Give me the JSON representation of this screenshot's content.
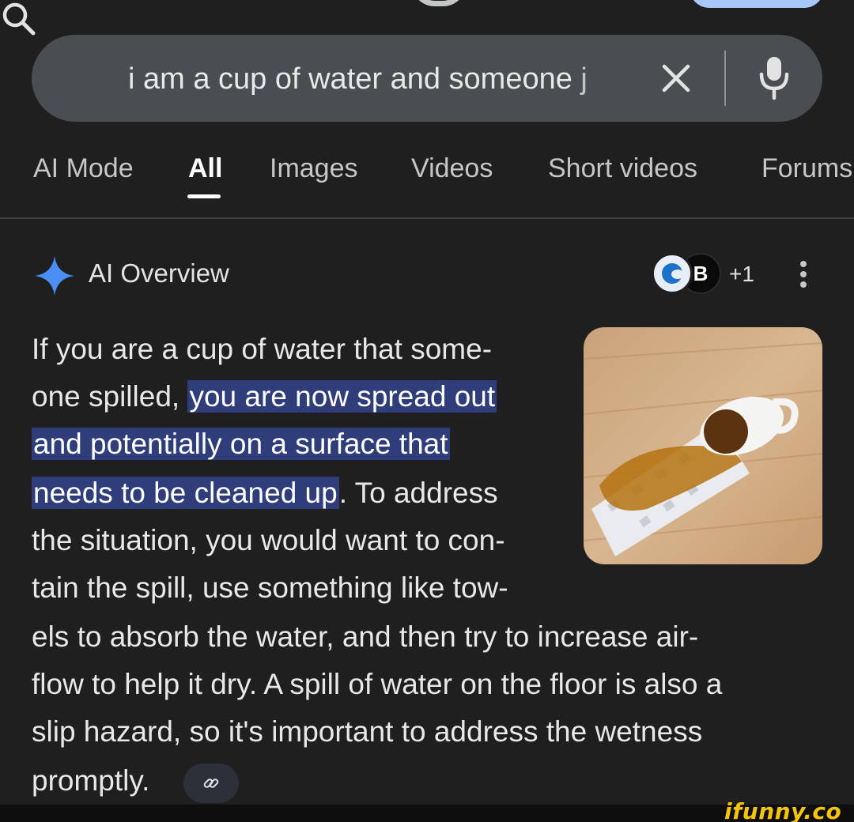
{
  "search": {
    "query": "i am a cup of water and someone j",
    "icons": {
      "search": "search-icon",
      "clear": "close-icon",
      "voice": "mic-icon"
    }
  },
  "tabs": [
    {
      "label": "AI Mode",
      "active": false
    },
    {
      "label": "All",
      "active": true
    },
    {
      "label": "Images",
      "active": false
    },
    {
      "label": "Videos",
      "active": false
    },
    {
      "label": "Short videos",
      "active": false
    },
    {
      "label": "Forums",
      "active": false
    }
  ],
  "ai_overview": {
    "title": "AI Overview",
    "source_badge_letter": "B",
    "more_sources": "+1",
    "lines": [
      {
        "pre": "If you are a cup of water that some-"
      },
      {
        "pre": "one spilled, ",
        "hl": "you are now spread out"
      },
      {
        "hl": "and potentially on a surface that"
      },
      {
        "hl": "needs to be cleaned up",
        "post": ". To address"
      },
      {
        "pre": "the situation, you would want to con-"
      },
      {
        "pre": "tain the spill, use something like tow-"
      },
      {
        "pre": "els to absorb the water, and then try to increase air-"
      },
      {
        "pre": "flow to help it dry. A spill of water on the floor is also a"
      },
      {
        "pre": "slip hazard, so it's important to address the wetness"
      },
      {
        "pre": "promptly."
      }
    ]
  },
  "colors": {
    "background": "#1f1f1f",
    "search_bar": "#4a4d51",
    "highlight": "#2f3d7a",
    "spark": "#4a8ff5"
  },
  "watermark": "ifunny.co"
}
